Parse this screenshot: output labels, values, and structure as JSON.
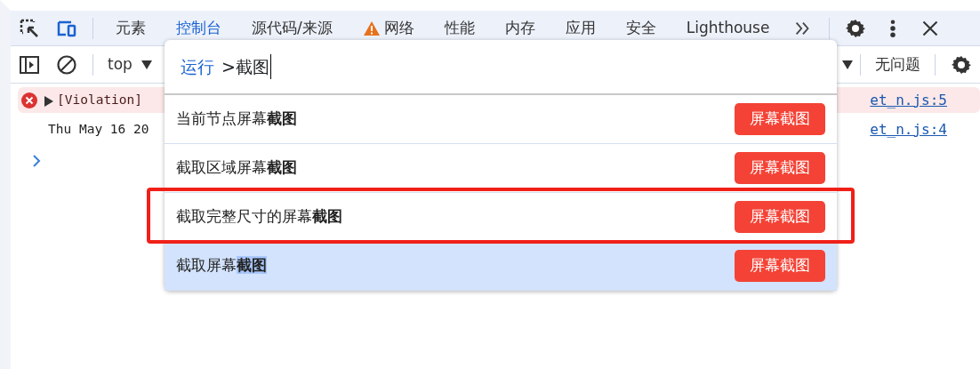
{
  "tabs": [
    {
      "label": "元素",
      "selected": false,
      "kind": "plain"
    },
    {
      "label": "控制台",
      "selected": true,
      "kind": "plain"
    },
    {
      "label": "源代码/来源",
      "selected": false,
      "kind": "plain"
    },
    {
      "label": "网络",
      "selected": false,
      "kind": "warning"
    },
    {
      "label": "性能",
      "selected": false,
      "kind": "plain"
    },
    {
      "label": "内存",
      "selected": false,
      "kind": "plain"
    },
    {
      "label": "应用",
      "selected": false,
      "kind": "plain"
    },
    {
      "label": "安全",
      "selected": false,
      "kind": "plain"
    },
    {
      "label": "Lighthouse",
      "selected": false,
      "kind": "plain"
    }
  ],
  "toolbar": {
    "context": "top",
    "issues": "无问题"
  },
  "console": [
    {
      "kind": "error",
      "text": "[Violation]",
      "source": "et_n.js:5"
    },
    {
      "kind": "log",
      "text": "Thu May 16 20",
      "source": "et_n.js:4"
    }
  ],
  "palette": {
    "prefix": "运行",
    "query": ">截图",
    "items": [
      {
        "text": "当前节点屏幕**截图**",
        "button": "屏幕截图",
        "selected": false,
        "annotated": false
      },
      {
        "text": "截取区域屏幕**截图**",
        "button": "屏幕截图",
        "selected": false,
        "annotated": false
      },
      {
        "text": "截取完整尺寸的屏幕**截图**",
        "button": "屏幕截图",
        "selected": false,
        "annotated": true
      },
      {
        "text": "截取屏幕**截图**",
        "button": "屏幕截图",
        "selected": true,
        "annotated": false
      }
    ]
  }
}
